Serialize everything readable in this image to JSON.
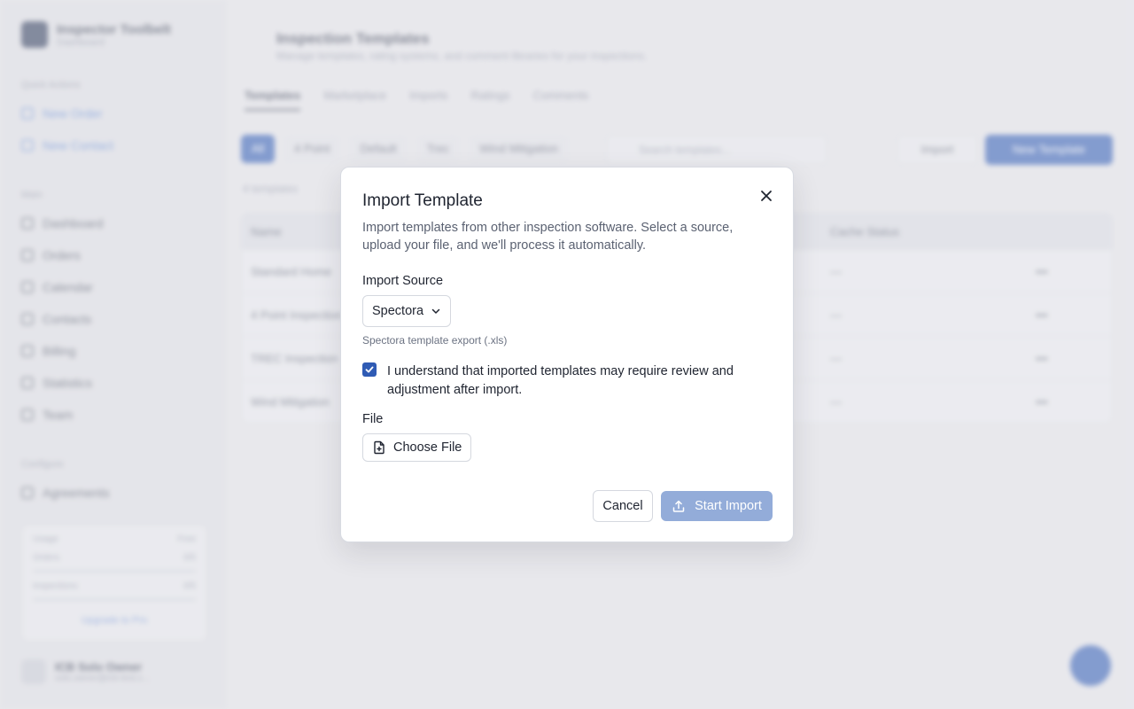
{
  "app": {
    "brand_name": "Inspector Toolbelt",
    "brand_sub": "Dashboard",
    "sidebar": {
      "quick_actions_title": "Quick Actions",
      "quick_actions": [
        {
          "label": "New Order",
          "icon": "plus-icon"
        },
        {
          "label": "New Contact",
          "icon": "user-plus-icon"
        }
      ],
      "main_title": "Main",
      "main_items": [
        {
          "label": "Dashboard",
          "icon": "grid-icon"
        },
        {
          "label": "Orders",
          "icon": "clipboard-icon"
        },
        {
          "label": "Calendar",
          "icon": "calendar-icon"
        },
        {
          "label": "Contacts",
          "icon": "contacts-icon"
        },
        {
          "label": "Billing",
          "icon": "billing-icon"
        },
        {
          "label": "Statistics",
          "icon": "chart-icon"
        },
        {
          "label": "Team",
          "icon": "team-icon"
        }
      ],
      "configure_title": "Configure",
      "configure_items": [
        {
          "label": "Agreements",
          "icon": "document-icon"
        }
      ],
      "usage": {
        "title": "Usage",
        "plan": "Free",
        "rows": [
          {
            "label": "Orders",
            "value": "0/5"
          },
          {
            "label": "Inspections",
            "value": "0/5"
          }
        ],
        "upgrade_label": "Upgrade to Pro"
      },
      "user": {
        "name": "ICB Solo Owner",
        "email": "solo.owner@icb-test.c..."
      }
    },
    "page": {
      "title": "Inspection Templates",
      "subtitle": "Manage templates, rating systems, and comment libraries for your inspections.",
      "tabs": [
        "Templates",
        "Marketplace",
        "Imports",
        "Ratings",
        "Comments"
      ],
      "filters": [
        "All",
        "4 Point",
        "Default",
        "Trec",
        "Wind Mitigation"
      ],
      "search_placeholder": "Search templates...",
      "import_label": "Import",
      "new_template_label": "New Template",
      "count_label": "4 templates",
      "table": {
        "headers": [
          "Name",
          "Cache Status"
        ],
        "rows": [
          {
            "name": "Standard Home",
            "cache": "—",
            "action": "•••"
          },
          {
            "name": "4 Point Inspection",
            "cache": "—",
            "action": "•••"
          },
          {
            "name": "TREC Inspection",
            "cache": "—",
            "action": "•••"
          },
          {
            "name": "Wind Mitigation",
            "cache": "—",
            "action": "•••"
          }
        ]
      }
    }
  },
  "dialog": {
    "title": "Import Template",
    "description": "Import templates from other inspection software. Select a source, upload your file, and we'll process it automatically.",
    "source_label": "Import Source",
    "source_value": "Spectora",
    "source_hint": "Spectora template export (.xls)",
    "checkbox_checked": true,
    "checkbox_text": "I understand that imported templates may require review and adjustment after import.",
    "file_label": "File",
    "choose_file_label": "Choose File",
    "cancel_label": "Cancel",
    "start_import_label": "Start Import"
  },
  "colors": {
    "accent": "#2f5bb4",
    "disabled_accent": "#93acd9"
  }
}
